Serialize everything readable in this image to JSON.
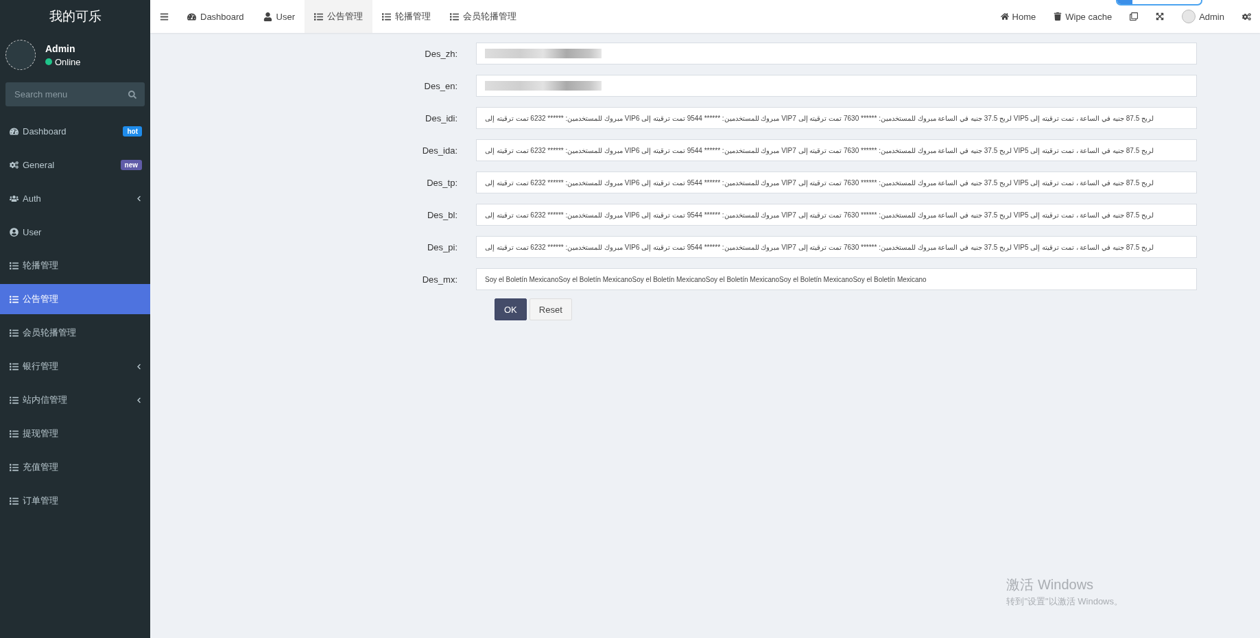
{
  "app": {
    "logo": "我的可乐"
  },
  "user_panel": {
    "name": "Admin",
    "status": "Online",
    "online": true
  },
  "search": {
    "placeholder": "Search menu"
  },
  "sidebar": {
    "items": [
      {
        "label": "Dashboard",
        "selected": false,
        "badge": {
          "text": "hot",
          "color": "#1f8ceb"
        }
      },
      {
        "label": "General",
        "selected": false,
        "badge": {
          "text": "new",
          "color": "#605ca8"
        }
      },
      {
        "label": "Auth",
        "selected": false,
        "has_children": true
      },
      {
        "label": "User",
        "selected": false
      },
      {
        "label": "轮播管理",
        "selected": false
      },
      {
        "label": "公告管理",
        "selected": true
      },
      {
        "label": "会员轮播管理",
        "selected": false
      },
      {
        "label": "银行管理",
        "selected": false,
        "has_children": true
      },
      {
        "label": "站内信管理",
        "selected": false,
        "has_children": true
      },
      {
        "label": "提现管理",
        "selected": false
      },
      {
        "label": "充值管理",
        "selected": false
      },
      {
        "label": "订单管理",
        "selected": false
      }
    ]
  },
  "top_tabs": [
    {
      "label": "Dashboard",
      "selected": false
    },
    {
      "label": "User",
      "selected": false
    },
    {
      "label": "公告管理",
      "selected": true
    },
    {
      "label": "轮播管理",
      "selected": false
    },
    {
      "label": "会员轮播管理",
      "selected": false
    }
  ],
  "top_progress": {
    "level": 0.18
  },
  "top_right": [
    {
      "kind": "link",
      "label": "Home"
    },
    {
      "kind": "link",
      "label": "Wipe cache"
    },
    {
      "kind": "icon"
    },
    {
      "kind": "icon"
    },
    {
      "kind": "user",
      "label": "Admin"
    },
    {
      "kind": "icon"
    }
  ],
  "form": {
    "fields": [
      {
        "label": "Des_zh:",
        "redacted": true
      },
      {
        "label": "Des_en:",
        "redacted": true
      },
      {
        "label": "Des_idi:",
        "value": "مبروك للمستخدمين: ****** 6232 تمت ترقيته إلى VIP6 مبروك للمستخدمين: ****** 9544 تمت ترقيته إلى VIP7 لربح 37.5 جنيه في الساعة  مبروك للمستخدمين: ****** 7630 تمت ترقيته إلى VIP5 لربح 87.5 جنيه في الساعة ، تمت ترقيته إلى"
      },
      {
        "label": "Des_ida:",
        "value": "مبروك للمستخدمين: ****** 6232 تمت ترقيته إلى VIP6 مبروك للمستخدمين: ****** 9544 تمت ترقيته إلى VIP7 لربح 37.5 جنيه في الساعة  مبروك للمستخدمين: ****** 7630 تمت ترقيته إلى VIP5 لربح 87.5 جنيه في الساعة ، تمت ترقيته إلى"
      },
      {
        "label": "Des_tp:",
        "value": "مبروك للمستخدمين: ****** 6232 تمت ترقيته إلى VIP6 مبروك للمستخدمين: ****** 9544 تمت ترقيته إلى VIP7 لربح 37.5 جنيه في الساعة  مبروك للمستخدمين: ****** 7630 تمت ترقيته إلى VIP5 لربح 87.5 جنيه في الساعة ، تمت ترقيته إلى"
      },
      {
        "label": "Des_bl:",
        "value": "مبروك للمستخدمين: ****** 6232 تمت ترقيته إلى VIP6 مبروك للمستخدمين: ****** 9544 تمت ترقيته إلى VIP7 لربح 37.5 جنيه في الساعة  مبروك للمستخدمين: ****** 7630 تمت ترقيته إلى VIP5 لربح 87.5 جنيه في الساعة ، تمت ترقيته إلى"
      },
      {
        "label": "Des_pi:",
        "value": "مبروك للمستخدمين: ****** 6232 تمت ترقيته إلى VIP6 مبروك للمستخدمين: ****** 9544 تمت ترقيته إلى VIP7 لربح 37.5 جنيه في الساعة  مبروك للمستخدمين: ****** 7630 تمت ترقيته إلى VIP5 لربح 87.5 جنيه في الساعة ، تمت ترقيته إلى"
      },
      {
        "label": "Des_mx:",
        "value": "Soy el Boletín MexicanoSoy el Boletín MexicanoSoy el Boletín MexicanoSoy el Boletín MexicanoSoy el Boletín MexicanoSoy el Boletín Mexicano"
      }
    ],
    "buttons": [
      {
        "label": "OK",
        "kind": "primary"
      },
      {
        "label": "Reset",
        "kind": "default"
      }
    ]
  },
  "os_notice": {
    "title": "激活 Windows",
    "subtitle": "转到\"设置\"以激活 Windows。"
  }
}
